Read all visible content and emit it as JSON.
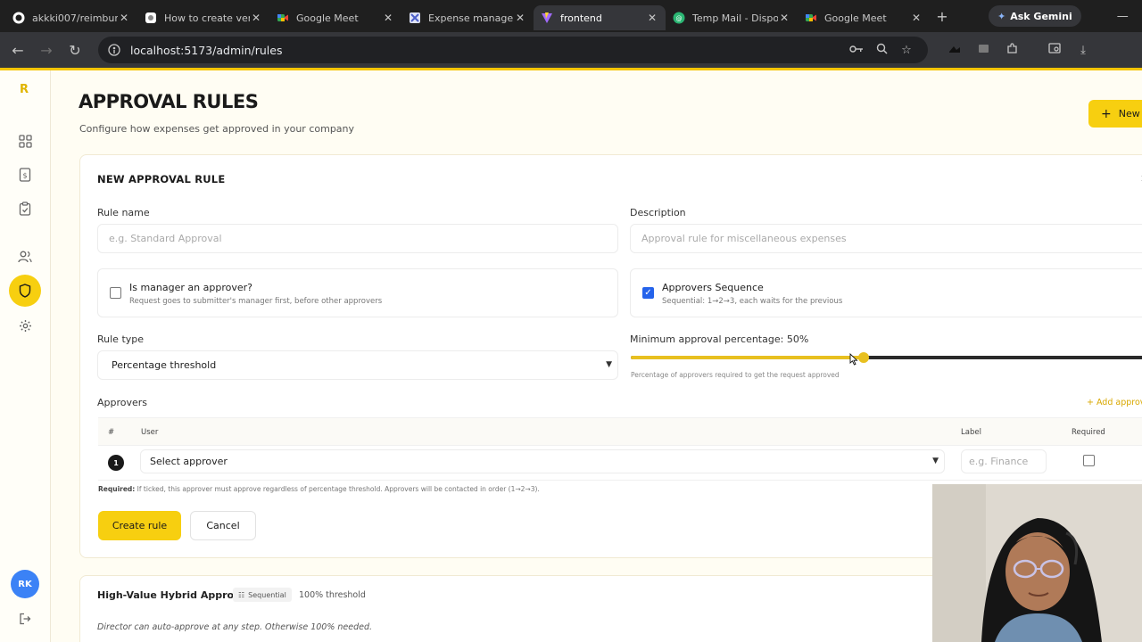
{
  "browser": {
    "tabs": [
      {
        "title": "akkki007/reimbur",
        "icon": "github-icon"
      },
      {
        "title": "How to create ven",
        "icon": "page-icon"
      },
      {
        "title": "Google Meet",
        "icon": "meet-icon"
      },
      {
        "title": "Expense managem",
        "icon": "app-icon"
      },
      {
        "title": "frontend",
        "icon": "vite-icon",
        "active": true
      },
      {
        "title": "Temp Mail - Dispo",
        "icon": "mail-icon"
      },
      {
        "title": "Google Meet",
        "icon": "meet-icon"
      }
    ],
    "ask_gemini": "Ask Gemini",
    "url": "localhost:5173/admin/rules"
  },
  "sidebar": {
    "logo": "R",
    "avatar_initials": "RK"
  },
  "page": {
    "title": "APPROVAL RULES",
    "subtitle": "Configure how expenses get approved in your company",
    "new_button": "New r"
  },
  "form": {
    "title": "NEW APPROVAL RULE",
    "rule_name_label": "Rule name",
    "rule_name_placeholder": "e.g. Standard Approval",
    "description_label": "Description",
    "description_placeholder": "Approval rule for miscellaneous expenses",
    "manager_title": "Is manager an approver?",
    "manager_sub": "Request goes to submitter's manager first, before other approvers",
    "manager_checked": false,
    "sequence_title": "Approvers Sequence",
    "sequence_sub": "Sequential: 1→2→3, each waits for the previous",
    "sequence_checked": true,
    "rule_type_label": "Rule type",
    "rule_type_value": "Percentage threshold",
    "min_pct_label": "Minimum approval percentage: 50%",
    "min_pct_value": 0.45,
    "min_pct_help": "Percentage of approvers required to get the request approved",
    "approvers_label": "Approvers",
    "add_approver": "+ Add approv",
    "table_headers": {
      "num": "#",
      "user": "User",
      "label": "Label",
      "required": "Required"
    },
    "row": {
      "num": "1",
      "user_select": "Select approver",
      "label_placeholder": "e.g. Finance"
    },
    "note_bold": "Required:",
    "note_rest": " If ticked, this approver must approve regardless of percentage threshold. Approvers will be contacted in order (1→2→3).",
    "create_button": "Create rule",
    "cancel_button": "Cancel"
  },
  "rule_card": {
    "name": "High-Value Hybrid Approval",
    "badge": "Sequential",
    "threshold": "100% threshold",
    "description": "Director can auto-approve at any step. Otherwise 100% needed."
  },
  "colors": {
    "accent": "#f7cf10",
    "checkbox": "#2563eb",
    "avatar": "#3b82f6"
  }
}
